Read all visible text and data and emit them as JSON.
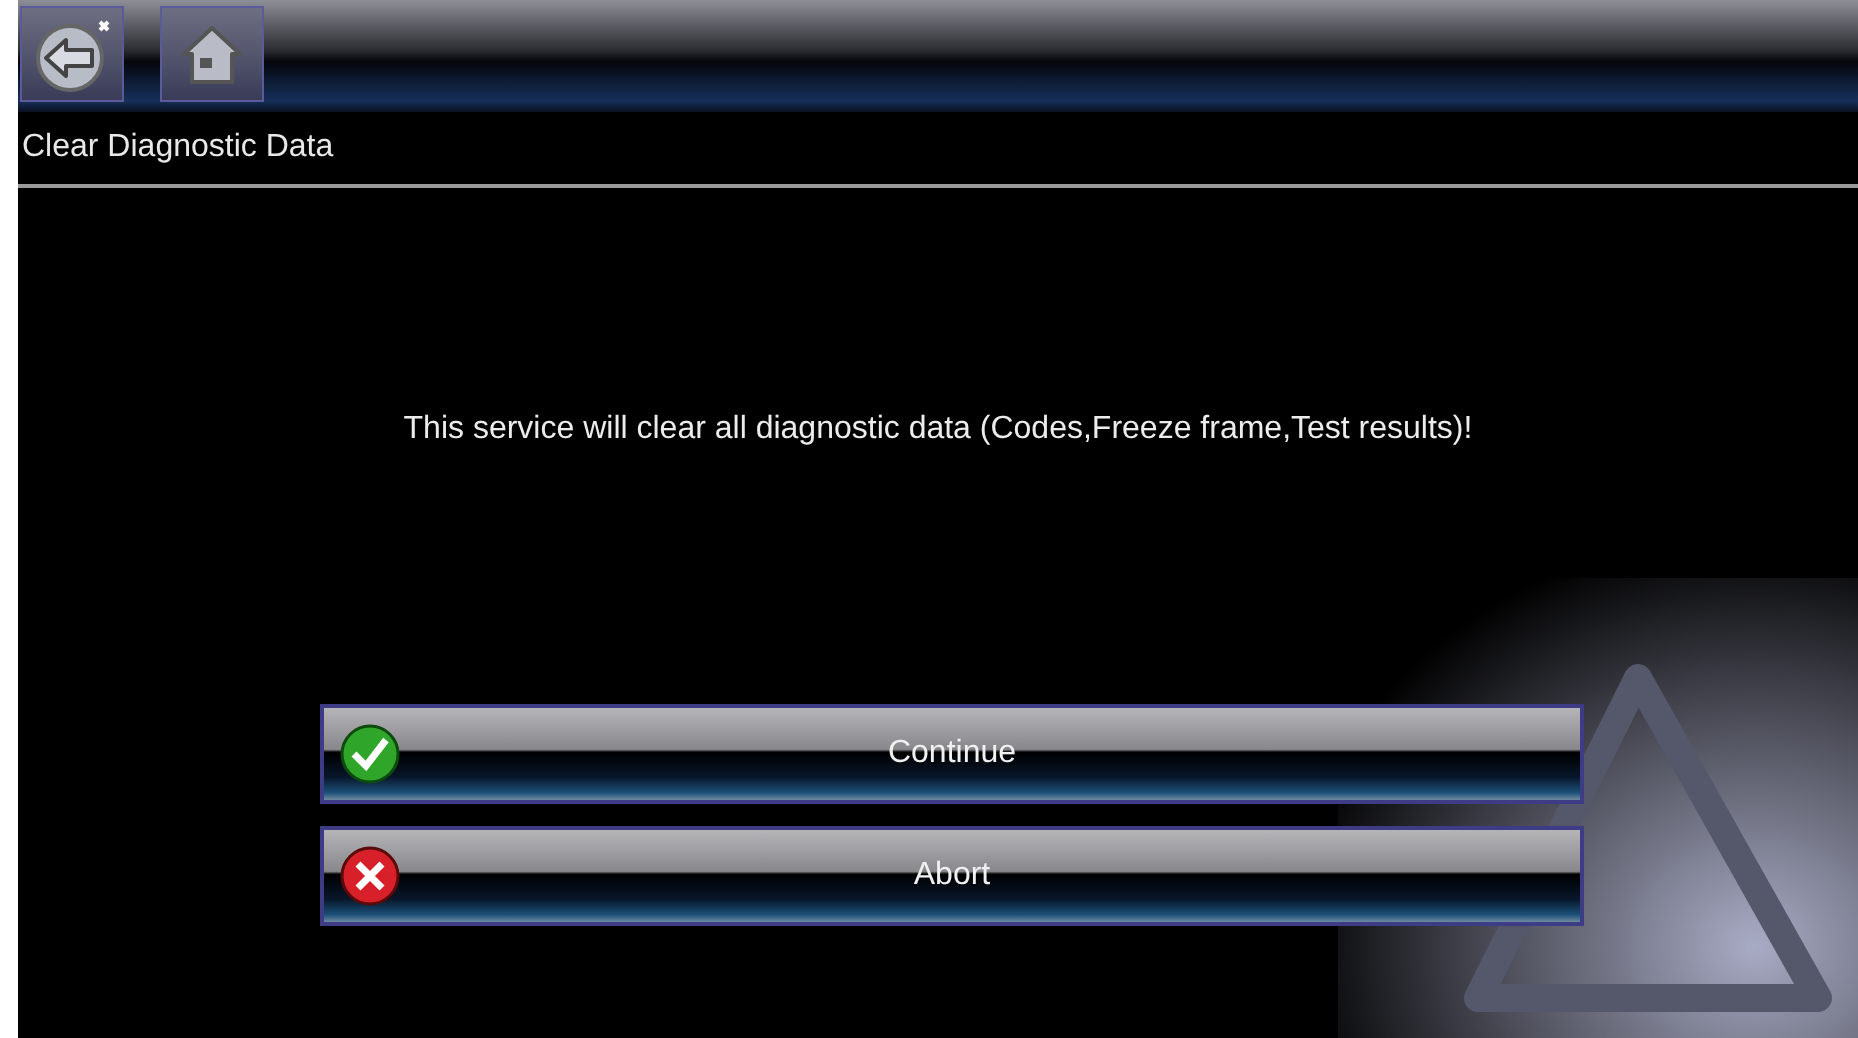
{
  "title_bar": {
    "title": "Clear Diagnostic Data"
  },
  "message": "This service will clear all diagnostic data (Codes,Freeze frame,Test results)!",
  "buttons": [
    {
      "label": "Continue",
      "kind": "confirm"
    },
    {
      "label": "Abort",
      "kind": "cancel"
    }
  ]
}
